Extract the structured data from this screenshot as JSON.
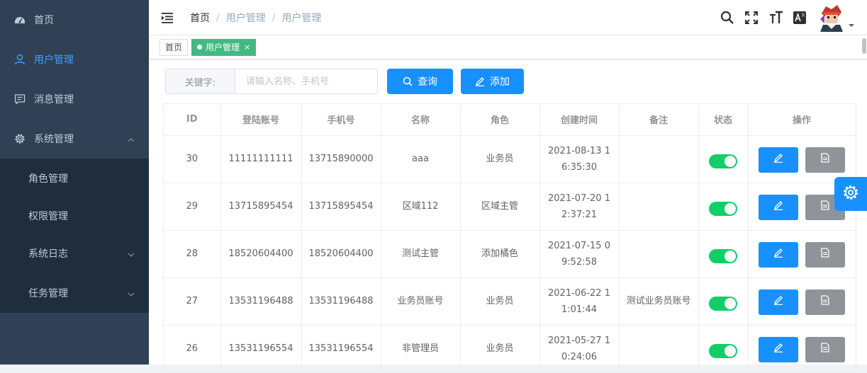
{
  "sidebar": {
    "items": [
      {
        "label": "首页",
        "icon": "dashboard-icon"
      },
      {
        "label": "用户管理",
        "icon": "user-icon",
        "active": true
      },
      {
        "label": "消息管理",
        "icon": "message-icon"
      },
      {
        "label": "系统管理",
        "icon": "gear-icon",
        "expanded": true
      }
    ],
    "submenu": [
      {
        "label": "角色管理"
      },
      {
        "label": "权限管理"
      },
      {
        "label": "系统日志",
        "has_children": true
      },
      {
        "label": "任务管理",
        "has_children": true
      }
    ]
  },
  "navbar": {
    "breadcrumb": [
      "首页",
      "用户管理",
      "用户管理"
    ]
  },
  "tags": {
    "home": "首页",
    "active": "用户管理",
    "close": "×"
  },
  "filter": {
    "label": "关键字:",
    "placeholder": "请输入名称、手机号",
    "search_label": "查询",
    "add_label": "添加"
  },
  "table": {
    "headers": [
      "ID",
      "登陆账号",
      "手机号",
      "名称",
      "角色",
      "创建时间",
      "备注",
      "状态",
      "操作"
    ],
    "rows": [
      {
        "id": "30",
        "account": "11111111111",
        "phone": "13715890000",
        "name": "aaa",
        "role": "业务员",
        "created": "2021-08-13 16:35:30",
        "remark": "",
        "enabled": true
      },
      {
        "id": "29",
        "account": "13715895454",
        "phone": "13715895454",
        "name": "区域112",
        "role": "区域主管",
        "created": "2021-07-20 12:37:21",
        "remark": "",
        "enabled": true
      },
      {
        "id": "28",
        "account": "18520604400",
        "phone": "18520604400",
        "name": "测试主管",
        "role": "添加橘色",
        "created": "2021-07-15 09:52:58",
        "remark": "",
        "enabled": true
      },
      {
        "id": "27",
        "account": "13531196488",
        "phone": "13531196488",
        "name": "业务员账号",
        "role": "业务员",
        "created": "2021-06-22 11:01:44",
        "remark": "测试业务员账号",
        "enabled": true
      },
      {
        "id": "26",
        "account": "13531196554",
        "phone": "13531196554",
        "name": "非管理员",
        "role": "业务员",
        "created": "2021-05-27 10:24:06",
        "remark": "",
        "enabled": true
      }
    ]
  },
  "colors": {
    "sidebar_bg": "#304156",
    "submenu_bg": "#1f2d3d",
    "primary": "#1890ff",
    "tag_active": "#42b983",
    "switch_on": "#13ce66",
    "detail_btn": "#909399"
  }
}
